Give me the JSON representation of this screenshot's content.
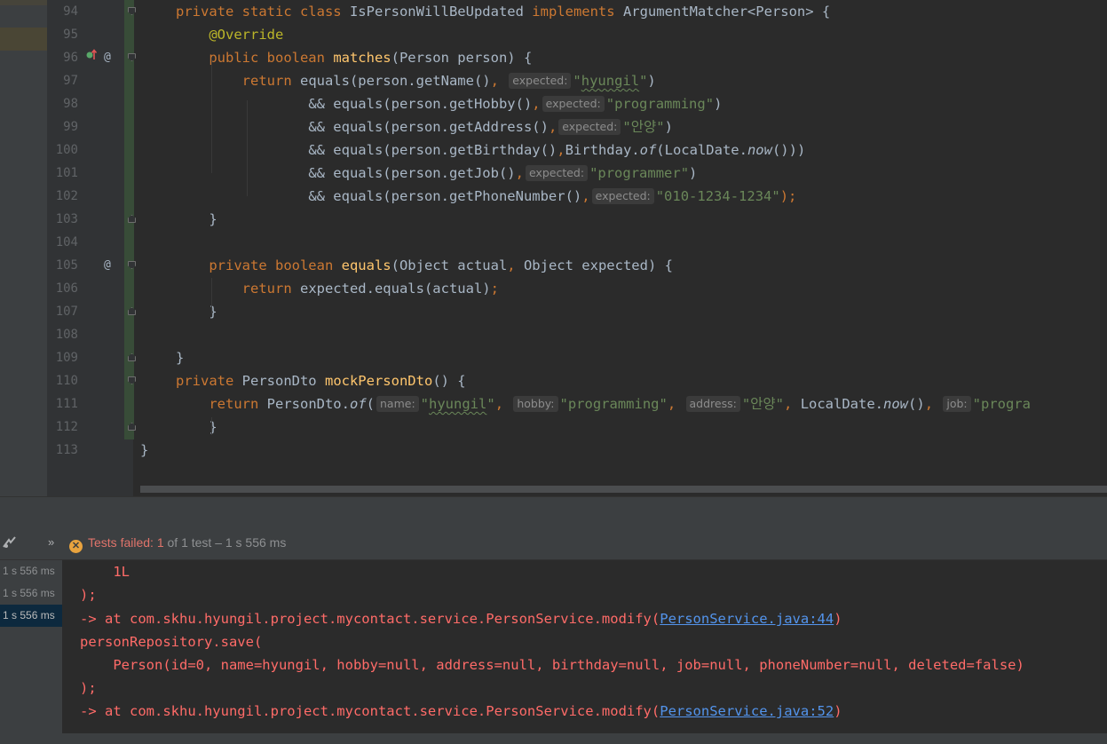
{
  "editor": {
    "lines": [
      {
        "num": "94",
        "segments": [
          {
            "t": "private static class ",
            "c": "kw"
          },
          {
            "t": "IsPersonWillBeUpdated ",
            "c": ""
          },
          {
            "t": "implements ",
            "c": "kw"
          },
          {
            "t": "ArgumentMatcher<Person> {",
            "c": ""
          }
        ]
      },
      {
        "num": "95",
        "segments": [
          {
            "t": "    ",
            "c": ""
          },
          {
            "t": "@Override",
            "c": "ann"
          }
        ]
      },
      {
        "num": "96",
        "segments": [
          {
            "t": "    ",
            "c": ""
          },
          {
            "t": "public boolean ",
            "c": "kw"
          },
          {
            "t": "matches",
            "c": "fn"
          },
          {
            "t": "(Person person) {",
            "c": ""
          }
        ]
      },
      {
        "num": "97",
        "segments": [
          {
            "t": "        ",
            "c": ""
          },
          {
            "t": "return ",
            "c": "kw"
          },
          {
            "t": "equals(person.getName()",
            "c": ""
          },
          {
            "t": ", ",
            "c": "kw"
          },
          {
            "t": "expected:",
            "c": "hint"
          },
          {
            "t": "\"",
            "c": "str"
          },
          {
            "t": "hyungil",
            "c": "str wavy"
          },
          {
            "t": "\"",
            "c": "str"
          },
          {
            "t": ")",
            "c": ""
          }
        ]
      },
      {
        "num": "98",
        "segments": [
          {
            "t": "                ",
            "c": ""
          },
          {
            "t": "&& equals(person.getHobby()",
            "c": ""
          },
          {
            "t": ",",
            "c": "kw"
          },
          {
            "t": "expected:",
            "c": "hint"
          },
          {
            "t": "\"programming\"",
            "c": "str"
          },
          {
            "t": ")",
            "c": ""
          }
        ]
      },
      {
        "num": "99",
        "segments": [
          {
            "t": "                ",
            "c": ""
          },
          {
            "t": "&& equals(person.getAddress()",
            "c": ""
          },
          {
            "t": ",",
            "c": "kw"
          },
          {
            "t": "expected:",
            "c": "hint"
          },
          {
            "t": "\"안양\"",
            "c": "str"
          },
          {
            "t": ")",
            "c": ""
          }
        ]
      },
      {
        "num": "100",
        "segments": [
          {
            "t": "                ",
            "c": ""
          },
          {
            "t": "&& equals(person.getBirthday()",
            "c": ""
          },
          {
            "t": ",",
            "c": "kw"
          },
          {
            "t": "Birthday.",
            "c": ""
          },
          {
            "t": "of",
            "c": "it"
          },
          {
            "t": "(LocalDate.",
            "c": ""
          },
          {
            "t": "now",
            "c": "it"
          },
          {
            "t": "()))",
            "c": ""
          }
        ]
      },
      {
        "num": "101",
        "segments": [
          {
            "t": "                ",
            "c": ""
          },
          {
            "t": "&& equals(person.getJob()",
            "c": ""
          },
          {
            "t": ",",
            "c": "kw"
          },
          {
            "t": "expected:",
            "c": "hint"
          },
          {
            "t": "\"programmer\"",
            "c": "str"
          },
          {
            "t": ")",
            "c": ""
          }
        ]
      },
      {
        "num": "102",
        "segments": [
          {
            "t": "                ",
            "c": ""
          },
          {
            "t": "&& equals(person.getPhoneNumber()",
            "c": ""
          },
          {
            "t": ",",
            "c": "kw"
          },
          {
            "t": "expected:",
            "c": "hint"
          },
          {
            "t": "\"010-1234-1234\"",
            "c": "str"
          },
          {
            "t": ");",
            "c": "kw"
          }
        ]
      },
      {
        "num": "103",
        "segments": [
          {
            "t": "    }",
            "c": ""
          }
        ]
      },
      {
        "num": "104",
        "segments": []
      },
      {
        "num": "105",
        "segments": [
          {
            "t": "    ",
            "c": ""
          },
          {
            "t": "private boolean ",
            "c": "kw"
          },
          {
            "t": "equals",
            "c": "fn"
          },
          {
            "t": "(Object actual",
            "c": ""
          },
          {
            "t": ", ",
            "c": "kw"
          },
          {
            "t": "Object expected) {",
            "c": ""
          }
        ]
      },
      {
        "num": "106",
        "segments": [
          {
            "t": "        ",
            "c": ""
          },
          {
            "t": "return ",
            "c": "kw"
          },
          {
            "t": "expected.equals(actual)",
            "c": ""
          },
          {
            "t": ";",
            "c": "kw"
          }
        ]
      },
      {
        "num": "107",
        "segments": [
          {
            "t": "    }",
            "c": ""
          }
        ]
      },
      {
        "num": "108",
        "segments": []
      },
      {
        "num": "109",
        "segments": [
          {
            "t": "}",
            "c": ""
          }
        ]
      },
      {
        "num": "110",
        "segments": [
          {
            "t": "private ",
            "c": "kw"
          },
          {
            "t": "PersonDto ",
            "c": ""
          },
          {
            "t": "mockPersonDto",
            "c": "fn"
          },
          {
            "t": "() {",
            "c": ""
          }
        ]
      },
      {
        "num": "111",
        "segments": [
          {
            "t": "    ",
            "c": ""
          },
          {
            "t": "return ",
            "c": "kw"
          },
          {
            "t": "PersonDto.",
            "c": ""
          },
          {
            "t": "of",
            "c": "it"
          },
          {
            "t": "(",
            "c": ""
          },
          {
            "t": "name:",
            "c": "hint"
          },
          {
            "t": "\"",
            "c": "str"
          },
          {
            "t": "hyungil",
            "c": "str wavy"
          },
          {
            "t": "\"",
            "c": "str"
          },
          {
            "t": ", ",
            "c": "kw"
          },
          {
            "t": "hobby:",
            "c": "hint"
          },
          {
            "t": "\"programming\"",
            "c": "str"
          },
          {
            "t": ", ",
            "c": "kw"
          },
          {
            "t": "address:",
            "c": "hint"
          },
          {
            "t": "\"안양\"",
            "c": "str"
          },
          {
            "t": ", ",
            "c": "kw"
          },
          {
            "t": "LocalDate.",
            "c": ""
          },
          {
            "t": "now",
            "c": "it"
          },
          {
            "t": "()",
            "c": ""
          },
          {
            "t": ", ",
            "c": "kw"
          },
          {
            "t": "job:",
            "c": "hint"
          },
          {
            "t": "\"progra",
            "c": "str"
          }
        ]
      },
      {
        "num": "112",
        "segments": [
          {
            "t": "    }",
            "c": ""
          }
        ]
      },
      {
        "num": "113",
        "segments": [
          {
            "t": "}",
            "c": ""
          }
        ]
      }
    ]
  },
  "run_panel": {
    "status_failed": "Tests failed: 1",
    "status_rest": " of 1 test – 1 s 556 ms",
    "tree_items": [
      "1 s 556 ms",
      "1 s 556 ms",
      "1 s 556 ms"
    ],
    "console_lines": [
      {
        "text": "    1L",
        "link": ""
      },
      {
        "text": ");",
        "link": ""
      },
      {
        "text": "-> at com.skhu.hyungil.project.mycontact.service.PersonService.modify(",
        "link": "PersonService.java:44",
        "after": ")"
      },
      {
        "text": "personRepository.save(",
        "link": ""
      },
      {
        "text": "    Person(id=0, name=hyungil, hobby=null, address=null, birthday=null, job=null, phoneNumber=null, deleted=false)",
        "link": ""
      },
      {
        "text": ");",
        "link": ""
      },
      {
        "text": "-> at com.skhu.hyungil.project.mycontact.service.PersonService.modify(",
        "link": "PersonService.java:52",
        "after": ")"
      }
    ]
  },
  "icons": {
    "gutter_96": [
      "override-marker-icon",
      "annotation-at-icon"
    ],
    "gutter_105": [
      "annotation-at-icon"
    ],
    "toolbar": [
      "run-test-icon",
      "expand-chevrons-icon",
      "error-status-icon"
    ]
  }
}
